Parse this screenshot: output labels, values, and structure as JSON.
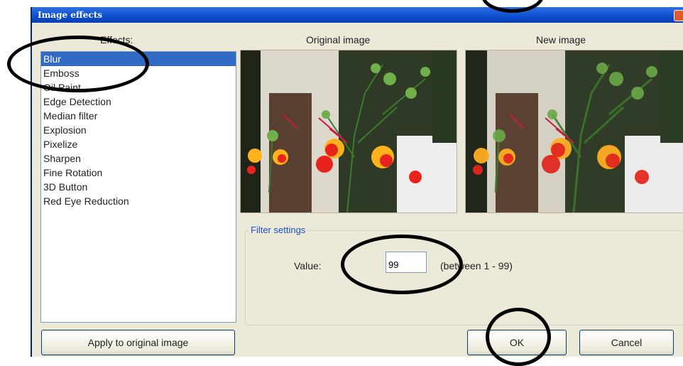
{
  "window": {
    "title": "Image effects"
  },
  "headers": {
    "effects": "Effects:",
    "original": "Original image",
    "new": "New image"
  },
  "effects": [
    {
      "label": "Blur",
      "selected": true
    },
    {
      "label": "Emboss",
      "selected": false
    },
    {
      "label": "Oil Paint",
      "selected": false
    },
    {
      "label": "Edge Detection",
      "selected": false
    },
    {
      "label": "Median filter",
      "selected": false
    },
    {
      "label": "Explosion",
      "selected": false
    },
    {
      "label": "Pixelize",
      "selected": false
    },
    {
      "label": "Sharpen",
      "selected": false
    },
    {
      "label": "Fine Rotation",
      "selected": false
    },
    {
      "label": "3D Button",
      "selected": false
    },
    {
      "label": "Red Eye Reduction",
      "selected": false
    }
  ],
  "filter": {
    "legend": "Filter settings",
    "value_label": "Value:",
    "value": "99",
    "range_hint": "(between 1 - 99)"
  },
  "buttons": {
    "apply": "Apply to original image",
    "ok": "OK",
    "cancel": "Cancel"
  },
  "colors": {
    "titlebar": "#0b4fd1",
    "selection": "#316ac5",
    "dialog_bg": "#ece9d8"
  }
}
